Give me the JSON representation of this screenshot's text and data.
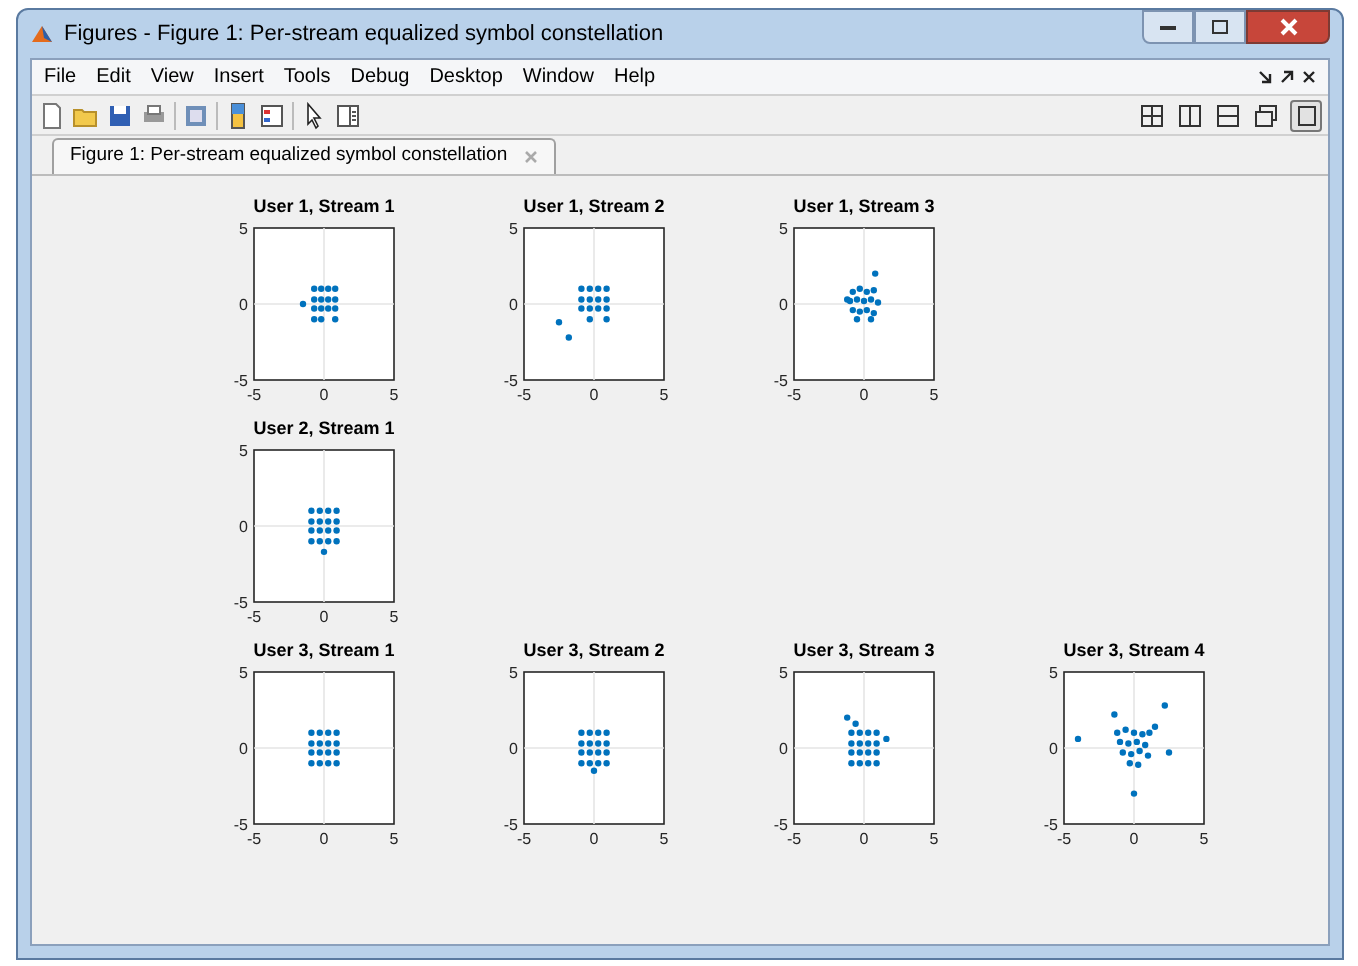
{
  "window": {
    "title": "Figures - Figure 1: Per-stream equalized symbol constellation"
  },
  "menu": [
    "File",
    "Edit",
    "View",
    "Insert",
    "Tools",
    "Debug",
    "Desktop",
    "Window",
    "Help"
  ],
  "tabs": [
    {
      "label": "Figure 1: Per-stream equalized symbol constellation",
      "selected": true
    }
  ],
  "rows": [
    {
      "plots": [
        {
          "chart_data": {
            "type": "scatter",
            "title": "User 1, Stream 1",
            "xlim": [
              -5,
              5
            ],
            "ylim": [
              -5,
              5
            ],
            "xticks": [
              -5,
              0,
              5
            ],
            "yticks": [
              -5,
              0,
              5
            ],
            "x": [
              -1.5,
              -0.7,
              -0.2,
              0.3,
              0.8,
              -0.7,
              -0.2,
              0.3,
              0.8,
              -0.7,
              -0.2,
              0.3,
              0.8,
              -0.7,
              -0.2,
              0.8
            ],
            "series": [
              {
                "color": "#0072bd",
                "values": [
                  0,
                  1,
                  1,
                  1,
                  1,
                  0.3,
                  0.3,
                  0.3,
                  0.3,
                  -0.3,
                  -0.3,
                  -0.3,
                  -0.3,
                  -1,
                  -1,
                  -1
                ]
              }
            ]
          }
        },
        {
          "chart_data": {
            "type": "scatter",
            "title": "User 1, Stream 2",
            "xlim": [
              -5,
              5
            ],
            "ylim": [
              -5,
              5
            ],
            "xticks": [
              -5,
              0,
              5
            ],
            "yticks": [
              -5,
              0,
              5
            ],
            "x": [
              -2.5,
              -1.8,
              -0.9,
              -0.3,
              0.3,
              0.9,
              -0.9,
              -0.3,
              0.3,
              0.9,
              -0.9,
              -0.3,
              0.3,
              0.9,
              -0.3,
              0.9
            ],
            "series": [
              {
                "color": "#0072bd",
                "values": [
                  -1.2,
                  -2.2,
                  1,
                  1,
                  1,
                  1,
                  0.3,
                  0.3,
                  0.3,
                  0.3,
                  -0.3,
                  -0.3,
                  -0.3,
                  -0.3,
                  -1,
                  -1
                ]
              }
            ]
          }
        },
        {
          "chart_data": {
            "type": "scatter",
            "title": "User 1, Stream 3",
            "xlim": [
              -5,
              5
            ],
            "ylim": [
              -5,
              5
            ],
            "xticks": [
              -5,
              0,
              5
            ],
            "yticks": [
              -5,
              0,
              5
            ],
            "x": [
              0.8,
              -1.2,
              -0.8,
              -0.3,
              0.2,
              0.7,
              -1,
              -0.5,
              0,
              0.5,
              1,
              -0.8,
              -0.3,
              0.2,
              0.7,
              -0.5,
              0.5
            ],
            "series": [
              {
                "color": "#0072bd",
                "values": [
                  2,
                  0.3,
                  0.8,
                  1,
                  0.8,
                  0.9,
                  0.2,
                  0.3,
                  0.2,
                  0.3,
                  0.1,
                  -0.4,
                  -0.5,
                  -0.4,
                  -0.6,
                  -1,
                  -1
                ]
              }
            ]
          }
        }
      ]
    },
    {
      "plots": [
        {
          "chart_data": {
            "type": "scatter",
            "title": "User 2, Stream 1",
            "xlim": [
              -5,
              5
            ],
            "ylim": [
              -5,
              5
            ],
            "xticks": [
              -5,
              0,
              5
            ],
            "yticks": [
              -5,
              0,
              5
            ],
            "x": [
              -0.9,
              -0.3,
              0.3,
              0.9,
              -0.9,
              -0.3,
              0.3,
              0.9,
              -0.9,
              -0.3,
              0.3,
              0.9,
              -0.9,
              -0.3,
              0.3,
              0.9,
              0
            ],
            "series": [
              {
                "color": "#0072bd",
                "values": [
                  1,
                  1,
                  1,
                  1,
                  0.3,
                  0.3,
                  0.3,
                  0.3,
                  -0.3,
                  -0.3,
                  -0.3,
                  -0.3,
                  -1,
                  -1,
                  -1,
                  -1,
                  -1.7
                ]
              }
            ]
          }
        }
      ]
    },
    {
      "plots": [
        {
          "chart_data": {
            "type": "scatter",
            "title": "User 3, Stream 1",
            "xlim": [
              -5,
              5
            ],
            "ylim": [
              -5,
              5
            ],
            "xticks": [
              -5,
              0,
              5
            ],
            "yticks": [
              -5,
              0,
              5
            ],
            "x": [
              -0.9,
              -0.3,
              0.3,
              0.9,
              -0.9,
              -0.3,
              0.3,
              0.9,
              -0.9,
              -0.3,
              0.3,
              0.9,
              -0.9,
              -0.3,
              0.3,
              0.9
            ],
            "series": [
              {
                "color": "#0072bd",
                "values": [
                  1,
                  1,
                  1,
                  1,
                  0.3,
                  0.3,
                  0.3,
                  0.3,
                  -0.3,
                  -0.3,
                  -0.3,
                  -0.3,
                  -1,
                  -1,
                  -1,
                  -1
                ]
              }
            ]
          }
        },
        {
          "chart_data": {
            "type": "scatter",
            "title": "User 3, Stream 2",
            "xlim": [
              -5,
              5
            ],
            "ylim": [
              -5,
              5
            ],
            "xticks": [
              -5,
              0,
              5
            ],
            "yticks": [
              -5,
              0,
              5
            ],
            "x": [
              -0.9,
              -0.3,
              0.3,
              0.9,
              -0.9,
              -0.3,
              0.3,
              0.9,
              -0.9,
              -0.3,
              0.3,
              0.9,
              -0.9,
              -0.3,
              0.3,
              0.9,
              0
            ],
            "series": [
              {
                "color": "#0072bd",
                "values": [
                  1,
                  1,
                  1,
                  1,
                  0.3,
                  0.3,
                  0.3,
                  0.3,
                  -0.3,
                  -0.3,
                  -0.3,
                  -0.3,
                  -1,
                  -1,
                  -1,
                  -1,
                  -1.5
                ]
              }
            ]
          }
        },
        {
          "chart_data": {
            "type": "scatter",
            "title": "User 3, Stream 3",
            "xlim": [
              -5,
              5
            ],
            "ylim": [
              -5,
              5
            ],
            "xticks": [
              -5,
              0,
              5
            ],
            "yticks": [
              -5,
              0,
              5
            ],
            "x": [
              -1.2,
              -0.6,
              1.6,
              -0.9,
              -0.3,
              0.3,
              0.9,
              -0.9,
              -0.3,
              0.3,
              0.9,
              -0.9,
              -0.3,
              0.3,
              0.9,
              -0.9,
              -0.3,
              0.3,
              0.9
            ],
            "series": [
              {
                "color": "#0072bd",
                "values": [
                  2,
                  1.6,
                  0.6,
                  1,
                  1,
                  1,
                  1,
                  0.3,
                  0.3,
                  0.3,
                  0.3,
                  -0.3,
                  -0.3,
                  -0.3,
                  -0.3,
                  -1,
                  -1,
                  -1,
                  -1
                ]
              }
            ]
          }
        },
        {
          "chart_data": {
            "type": "scatter",
            "title": "User 3, Stream 4",
            "xlim": [
              -5,
              5
            ],
            "ylim": [
              -5,
              5
            ],
            "xticks": [
              -5,
              0,
              5
            ],
            "yticks": [
              -5,
              0,
              5
            ],
            "x": [
              -4,
              -1.4,
              1.5,
              2.2,
              -1.2,
              -0.6,
              0,
              0.6,
              1.1,
              -1,
              -0.4,
              0.2,
              0.8,
              -0.8,
              -0.2,
              0.4,
              1,
              -0.3,
              0.3,
              0,
              2.5
            ],
            "series": [
              {
                "color": "#0072bd",
                "values": [
                  0.6,
                  2.2,
                  1.4,
                  2.8,
                  1,
                  1.2,
                  1,
                  0.9,
                  1,
                  0.4,
                  0.3,
                  0.4,
                  0.2,
                  -0.3,
                  -0.4,
                  -0.2,
                  -0.5,
                  -1,
                  -1.1,
                  -3,
                  -0.3
                ]
              }
            ]
          }
        }
      ]
    }
  ]
}
